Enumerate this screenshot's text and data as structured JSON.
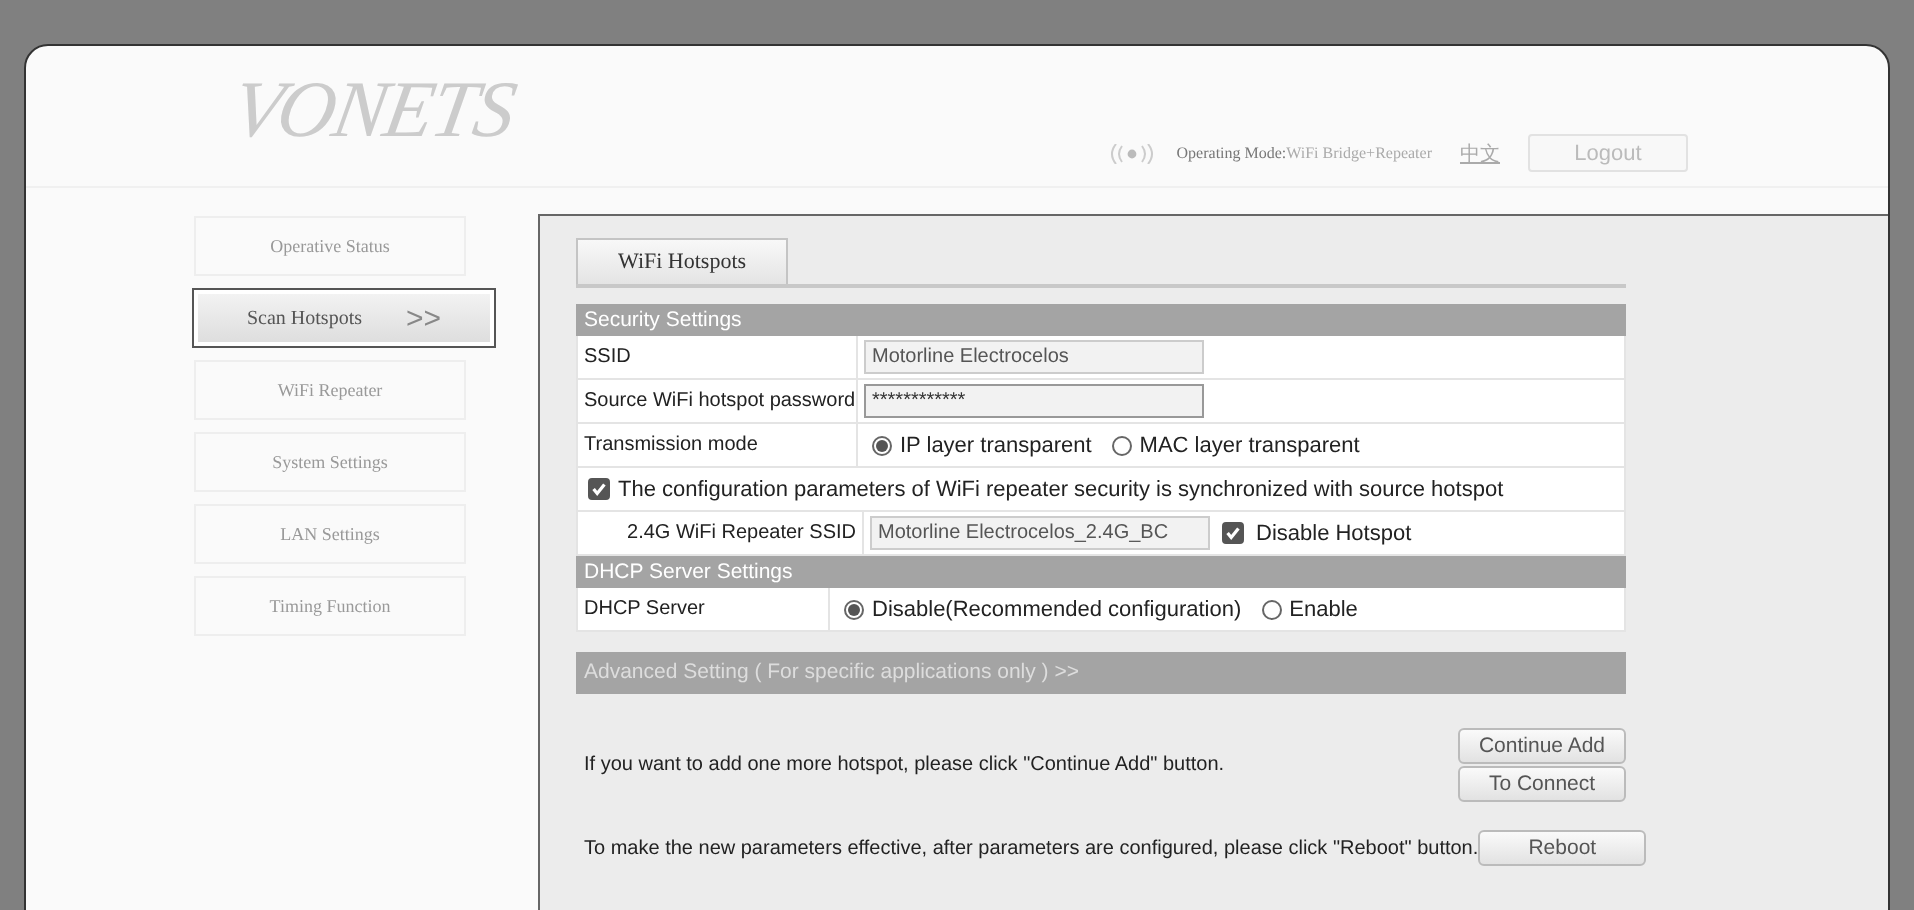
{
  "header": {
    "logo": "VONETS",
    "operating_mode_label": "Operating Mode:",
    "operating_mode_value": "WiFi Bridge+Repeater",
    "language": "中文",
    "logout": "Logout"
  },
  "sidebar": {
    "marker": ">>",
    "items": [
      {
        "label": "Operative Status",
        "selected": false
      },
      {
        "label": "Scan Hotspots",
        "selected": true
      },
      {
        "label": "WiFi Repeater",
        "selected": false
      },
      {
        "label": "System Settings",
        "selected": false
      },
      {
        "label": "LAN Settings",
        "selected": false
      },
      {
        "label": "Timing Function",
        "selected": false
      }
    ]
  },
  "tabs": [
    {
      "label": "WiFi Hotspots",
      "selected": true
    }
  ],
  "sections": [
    {
      "title": "Security Settings",
      "rows": [
        {
          "kind": "field",
          "label": "SSID",
          "value": "Motorline Electrocelos"
        },
        {
          "kind": "password",
          "label": "Source WiFi hotspot password",
          "value": "************"
        },
        {
          "kind": "radio",
          "label": "Transmission mode",
          "options": [
            {
              "label": "IP layer transparent",
              "selected": true
            },
            {
              "label": "MAC layer transparent",
              "selected": false
            }
          ]
        },
        {
          "kind": "checkbox",
          "label": "The configuration parameters of WiFi repeater security is synchronized with source hotspot",
          "checked": true
        },
        {
          "kind": "field_check",
          "label": "2.4G WiFi Repeater SSID",
          "value": "Motorline Electrocelos_2.4G_BC",
          "check_label": "Disable Hotspot",
          "checked": true
        }
      ]
    },
    {
      "title": "DHCP Server Settings",
      "rows": [
        {
          "kind": "radio",
          "label": "DHCP Server",
          "options": [
            {
              "label": "Disable(Recommended configuration)",
              "selected": true
            },
            {
              "label": "Enable",
              "selected": false
            }
          ]
        }
      ]
    }
  ],
  "advanced": "Advanced Setting ( For specific applications only ) >>",
  "actions": [
    {
      "text": "If you want to add one more hotspot, please click \"Continue Add\" button.",
      "buttons": [
        "Continue Add",
        "To Connect"
      ]
    },
    {
      "text": "To make the new parameters effective, after parameters are configured, please click \"Reboot\" button.",
      "buttons": [
        "Reboot"
      ]
    }
  ]
}
